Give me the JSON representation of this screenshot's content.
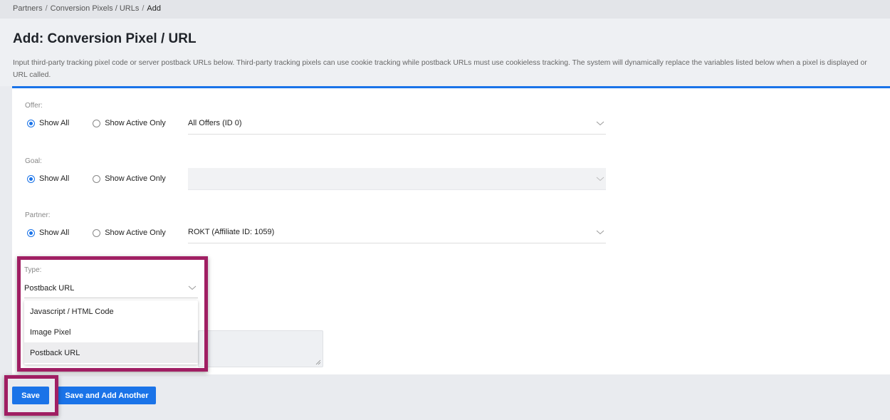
{
  "breadcrumb": {
    "items": [
      "Partners",
      "Conversion Pixels / URLs"
    ],
    "separator": "/",
    "current": "Add"
  },
  "page": {
    "title": "Add: Conversion Pixel / URL",
    "description": "Input third-party tracking pixel code or server postback URLs below. Third-party tracking pixels can use cookie tracking while postback URLs must use cookieless tracking. The system will dynamically replace the variables listed below when a pixel is displayed or URL called."
  },
  "form": {
    "offer": {
      "label": "Offer:",
      "radio_all": "Show All",
      "radio_active": "Show Active Only",
      "selected": "All Offers (ID 0)"
    },
    "goal": {
      "label": "Goal:",
      "radio_all": "Show All",
      "radio_active": "Show Active Only",
      "selected": ""
    },
    "partner": {
      "label": "Partner:",
      "radio_all": "Show All",
      "radio_active": "Show Active Only",
      "selected": "ROKT (Affiliate ID: 1059)"
    },
    "type": {
      "label": "Type:",
      "selected": "Postback URL",
      "options": [
        "Javascript / HTML Code",
        "Image Pixel",
        "Postback URL"
      ]
    }
  },
  "buttons": {
    "save": "Save",
    "save_another": "Save and Add Another"
  },
  "colors": {
    "accent": "#1a73e8",
    "highlight": "#a01f63"
  }
}
